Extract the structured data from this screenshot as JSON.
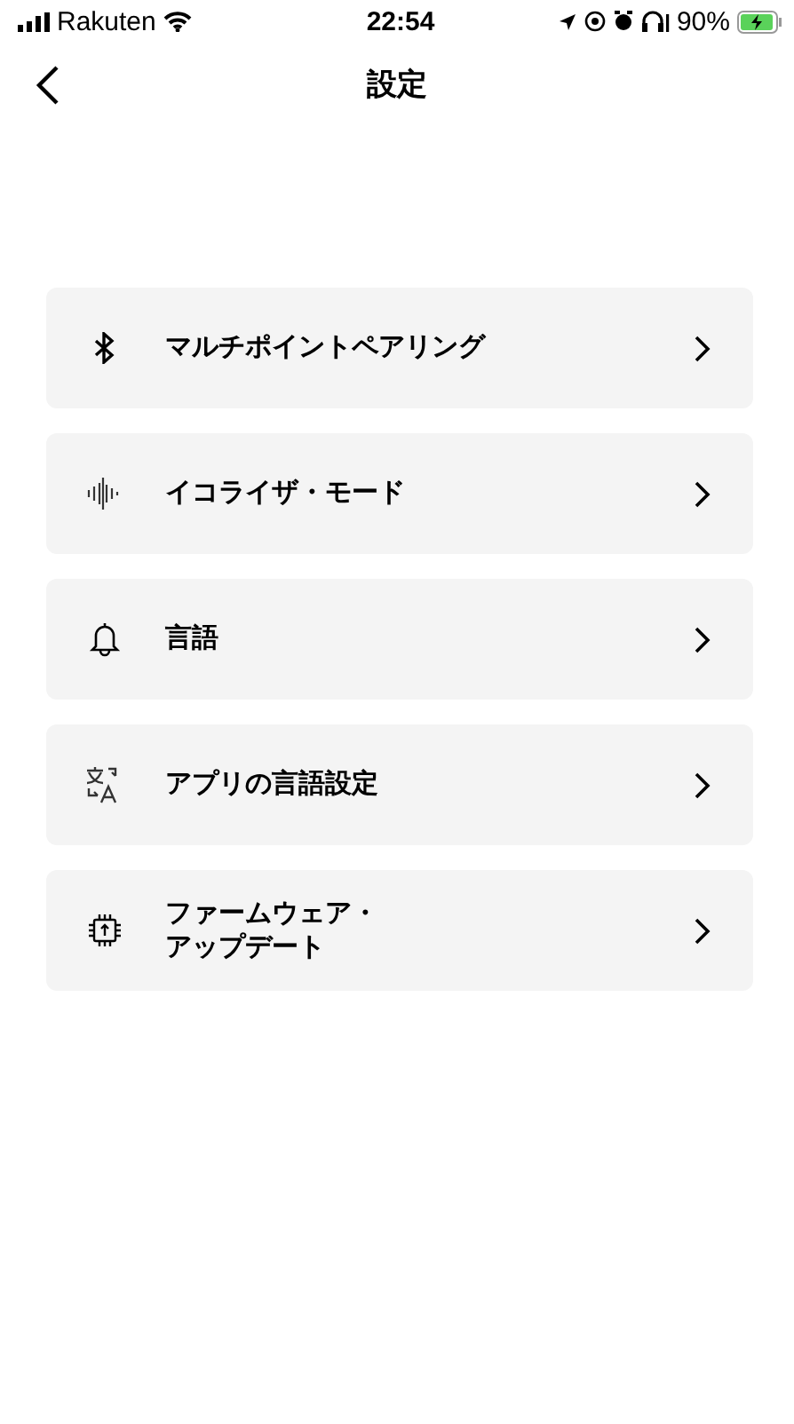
{
  "status_bar": {
    "carrier": "Rakuten",
    "time": "22:54",
    "battery": "90%"
  },
  "nav": {
    "title": "設定"
  },
  "items": [
    {
      "kind": "bluetooth",
      "label_lines": [
        "マルチポイントペアリング"
      ]
    },
    {
      "kind": "equalizer",
      "label_lines": [
        "イコライザ・モード"
      ]
    },
    {
      "kind": "bell",
      "label_lines": [
        "言語"
      ]
    },
    {
      "kind": "translate",
      "label_lines": [
        "アプリの言語設定"
      ]
    },
    {
      "kind": "chip",
      "label_lines": [
        "ファームウェア・",
        "アップデート"
      ]
    }
  ]
}
